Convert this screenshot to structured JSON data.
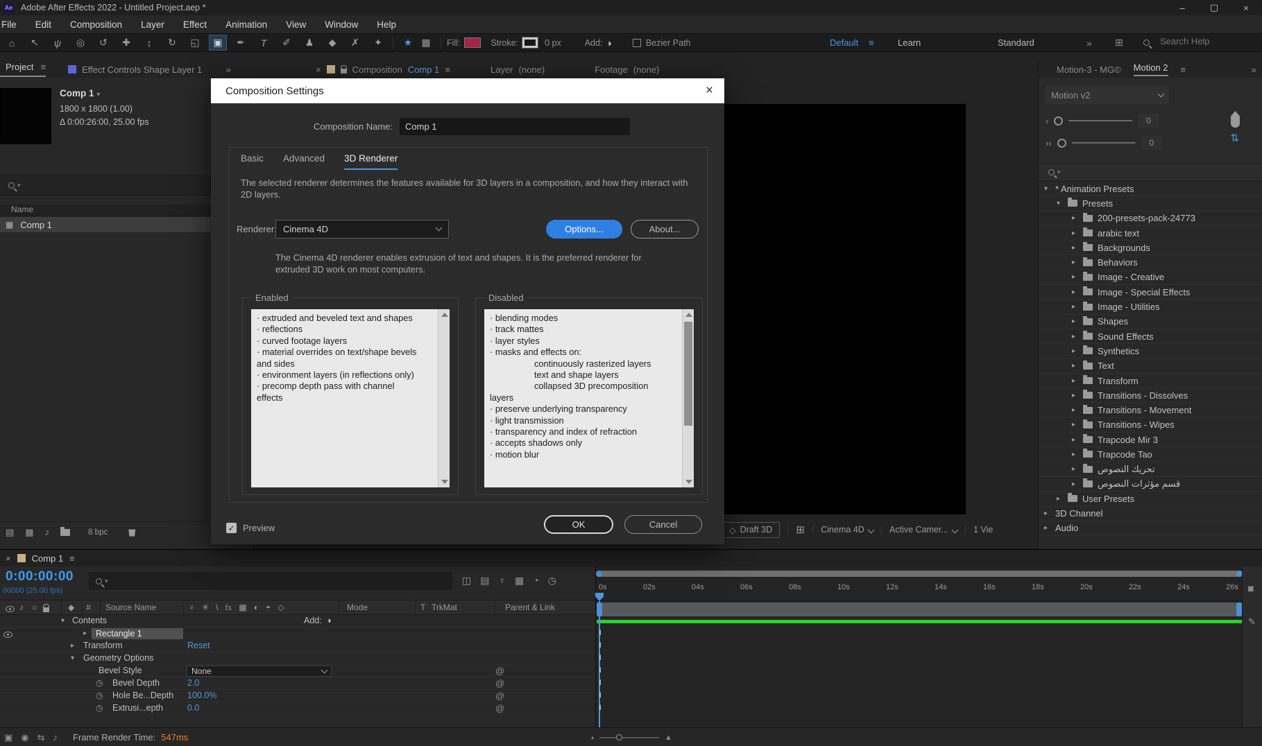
{
  "colors": {
    "accent_blue": "#4796e3",
    "fill_red": "#a32648",
    "render_bar_green": "#2ad42a",
    "frame_time_orange": "#ef7e28",
    "dialog_title_bg": "#ffffff"
  },
  "window": {
    "title": "Adobe After Effects 2022 - Untitled Project.aep *",
    "logo": "Ae",
    "minimize": "–",
    "maximize": "▢",
    "close": "×"
  },
  "menu": [
    "File",
    "Edit",
    "Composition",
    "Layer",
    "Effect",
    "Animation",
    "View",
    "Window",
    "Help"
  ],
  "toolbar": {
    "tools": [
      {
        "name": "home-tool",
        "glyph": "⌂",
        "cls": ""
      },
      {
        "name": "selection-tool",
        "glyph": "↖",
        "cls": ""
      },
      {
        "name": "hand-tool",
        "glyph": "ψ",
        "cls": ""
      },
      {
        "name": "zoom-tool",
        "glyph": "◎",
        "cls": ""
      },
      {
        "name": "orbit-camera-tool",
        "glyph": "↺",
        "cls": ""
      },
      {
        "name": "pan-camera-tool",
        "glyph": "✚",
        "cls": ""
      },
      {
        "name": "dolly-camera-tool",
        "glyph": "↕",
        "cls": ""
      },
      {
        "name": "rotation-tool",
        "glyph": "↻",
        "cls": ""
      },
      {
        "name": "pan-behind-tool",
        "glyph": "◱",
        "cls": ""
      },
      {
        "name": "rectangle-tool",
        "glyph": "▣",
        "cls": "active"
      },
      {
        "name": "pen-tool",
        "glyph": "✒",
        "cls": ""
      },
      {
        "name": "type-tool",
        "glyph": "T",
        "cls": ""
      },
      {
        "name": "brush-tool",
        "glyph": "✐",
        "cls": ""
      },
      {
        "name": "clone-stamp-tool",
        "glyph": "♟",
        "cls": ""
      },
      {
        "name": "eraser-tool",
        "glyph": "◆",
        "cls": ""
      },
      {
        "name": "roto-brush-tool",
        "glyph": "✗",
        "cls": ""
      },
      {
        "name": "puppet-pin-tool",
        "glyph": "✦",
        "cls": ""
      }
    ],
    "star_icon": "★",
    "grid_icon": "▦",
    "fill_label": "Fill:",
    "stroke_label": "Stroke:",
    "stroke_width": "0 px",
    "add_label": "Add:",
    "add_icon": "◑",
    "bezier_label": "Bezier Path",
    "workspace": "Default",
    "workspace_menu_icon": "≡",
    "learn": "Learn",
    "standard": "Standard",
    "overflow_icon": "»",
    "panel_icon": "⊞",
    "search_placeholder": "Search Help"
  },
  "project": {
    "tab": "Project",
    "panel_menu_icon": "≡",
    "tab_effect_controls": "Effect Controls Shape Layer 1",
    "overflow_icon": "»",
    "comp_name": "Comp 1",
    "comp_caret": "▾",
    "dims": "1800 x 1800 (1.00)",
    "duration": "Δ 0:00:26:00, 25.00 fps",
    "name_col": "Name",
    "row_comp": "Comp 1",
    "row_icon": "▦",
    "footer_icons": [
      {
        "name": "flowchart-icon",
        "glyph": "▤"
      },
      {
        "name": "grid-icon",
        "glyph": "▦"
      },
      {
        "name": "speaker-icon",
        "glyph": "♪"
      }
    ],
    "bpc": "8 bpc"
  },
  "viewer": {
    "tab_close": "×",
    "tab_label": "Composition",
    "tab_comp": "Comp 1",
    "panel_menu_icon": "≡",
    "layer_label": "Layer",
    "layer_value": "(none)",
    "footage_label": "Footage",
    "footage_value": "(none)",
    "draft3d_icon": "◇",
    "draft3d": "Draft 3D",
    "layout_icon": "⊞",
    "renderer": "Cinema 4D",
    "camera": "Active Camer...",
    "views": "1 Vie"
  },
  "dialog": {
    "title": "Composition Settings",
    "close": "×",
    "name_label": "Composition Name:",
    "name_value": "Comp 1",
    "tabs": [
      {
        "label": "Basic",
        "cls": ""
      },
      {
        "label": "Advanced",
        "cls": ""
      },
      {
        "label": "3D Renderer",
        "cls": "active"
      }
    ],
    "description_line1": "The selected renderer determines the features available for 3D layers in a composition, and how they interact with",
    "description_line2": "2D layers.",
    "renderer_label": "Renderer:",
    "renderer_value": "Cinema 4D",
    "options_button": "Options...",
    "about_button": "About...",
    "note_line1": "The Cinema 4D renderer enables extrusion of text and shapes. It is the preferred renderer for",
    "note_line2": "extruded 3D work on most computers.",
    "enabled_label": "Enabled",
    "enabled_items": [
      {
        "t": "· extruded and beveled text and shapes",
        "cls": ""
      },
      {
        "t": "· reflections",
        "cls": ""
      },
      {
        "t": "· curved footage layers",
        "cls": ""
      },
      {
        "t": "· material overrides on text/shape bevels",
        "cls": ""
      },
      {
        "t": "and sides",
        "cls": ""
      },
      {
        "t": "· environment layers (in reflections only)",
        "cls": ""
      },
      {
        "t": "· precomp depth pass with channel",
        "cls": ""
      },
      {
        "t": "effects",
        "cls": ""
      }
    ],
    "disabled_label": "Disabled",
    "disabled_items": [
      {
        "t": "· blending modes",
        "cls": ""
      },
      {
        "t": "· track mattes",
        "cls": ""
      },
      {
        "t": "· layer styles",
        "cls": ""
      },
      {
        "t": "· masks and effects on:",
        "cls": ""
      },
      {
        "t": "continuously rasterized layers",
        "cls": "ind"
      },
      {
        "t": "text and shape layers",
        "cls": "ind"
      },
      {
        "t": "collapsed 3D precomposition",
        "cls": "ind"
      },
      {
        "t": "layers",
        "cls": ""
      },
      {
        "t": "· preserve underlying transparency",
        "cls": ""
      },
      {
        "t": "· light transmission",
        "cls": ""
      },
      {
        "t": "· transparency and index of refraction",
        "cls": ""
      },
      {
        "t": "· accepts shadows only",
        "cls": ""
      },
      {
        "t": "· motion blur",
        "cls": ""
      }
    ],
    "preview_label": "Preview",
    "preview_check": "✓",
    "ok": "OK",
    "cancel": "Cancel"
  },
  "presets": {
    "tab1": "Motion-3 - MG©",
    "tab2": "Motion 2",
    "panel_menu_icon": "≡",
    "overflow_icon": "»",
    "dropdown": "Motion v2",
    "slider1_icon": "‹",
    "slider1_value": "0",
    "slider2_icon": "›‹",
    "slider2_value": "0",
    "updown_icon": "⇅",
    "tree": [
      {
        "label": "* Animation Presets",
        "cls": "lvl0 open"
      },
      {
        "label": "Presets",
        "cls": "lvl1 open folder"
      },
      {
        "label": "200-presets-pack-24773",
        "cls": "lvl2 closed folder"
      },
      {
        "label": "arabic text",
        "cls": "lvl2 closed folder"
      },
      {
        "label": "Backgrounds",
        "cls": "lvl2 closed folder"
      },
      {
        "label": "Behaviors",
        "cls": "lvl2 closed folder"
      },
      {
        "label": "Image - Creative",
        "cls": "lvl2 closed folder"
      },
      {
        "label": "Image - Special Effects",
        "cls": "lvl2 closed folder"
      },
      {
        "label": "Image - Utilities",
        "cls": "lvl2 closed folder"
      },
      {
        "label": "Shapes",
        "cls": "lvl2 closed folder"
      },
      {
        "label": "Sound Effects",
        "cls": "lvl2 closed folder"
      },
      {
        "label": "Synthetics",
        "cls": "lvl2 closed folder"
      },
      {
        "label": "Text",
        "cls": "lvl2 closed folder"
      },
      {
        "label": "Transform",
        "cls": "lvl2 closed folder"
      },
      {
        "label": "Transitions - Dissolves",
        "cls": "lvl2 closed folder"
      },
      {
        "label": "Transitions - Movement",
        "cls": "lvl2 closed folder"
      },
      {
        "label": "Transitions - Wipes",
        "cls": "lvl2 closed folder"
      },
      {
        "label": "Trapcode Mir 3",
        "cls": "lvl2 closed folder"
      },
      {
        "label": "Trapcode Tao",
        "cls": "lvl2 closed folder"
      },
      {
        "label": "تحريك النصوص",
        "cls": "lvl2 closed folder"
      },
      {
        "label": "قسم مؤثرات النصوص",
        "cls": "lvl2 closed folder"
      },
      {
        "label": "User Presets",
        "cls": "lvl1 closed folder"
      },
      {
        "label": "3D Channel",
        "cls": "lvl0 closed"
      },
      {
        "label": "Audio",
        "cls": "lvl0 closed"
      }
    ]
  },
  "timeline": {
    "tab_close": "×",
    "tab": "Comp 1",
    "panel_menu_icon": "≡",
    "timecode": "0:00:00:00",
    "frames": "00000 (25.00 fps)",
    "cluster_icons": [
      {
        "name": "comp-mini-flowchart-icon",
        "glyph": "◫"
      },
      {
        "name": "draft-3d-toggle-icon",
        "glyph": "▤"
      },
      {
        "name": "hide-shy-layers-icon",
        "glyph": "♀"
      },
      {
        "name": "frame-blending-toggle-icon",
        "glyph": "▦"
      },
      {
        "name": "motion-blur-toggle-icon",
        "glyph": "◔"
      },
      {
        "name": "graph-editor-icon",
        "glyph": "◷"
      }
    ],
    "header": {
      "hash": "#",
      "source": "Source Name",
      "mode": "Mode",
      "t": "T",
      "trkmat": "TrkMat",
      "parent": "Parent & Link",
      "tag_icon": "◆",
      "audio_icon": "♪",
      "solo_icon": "○"
    },
    "switch_icons": [
      {
        "name": "shy-icon",
        "glyph": "♀"
      },
      {
        "name": "collapse-transformations-icon",
        "glyph": "✳"
      },
      {
        "name": "quality-icon",
        "glyph": "\\"
      },
      {
        "name": "fx-icon",
        "glyph": "fx"
      },
      {
        "name": "frame-blend-icon",
        "glyph": "▦"
      },
      {
        "name": "motion-blur-icon",
        "glyph": "◐"
      },
      {
        "name": "adjustment-layer-icon",
        "glyph": "◓"
      },
      {
        "name": "3d-layer-icon",
        "glyph": "◇"
      }
    ],
    "row_contents": "Contents",
    "add_label": "Add:",
    "add_icon": "◑",
    "row_rect": "Rectangle 1",
    "row_transform": "Transform",
    "transform_value": "Reset",
    "row_geo": "Geometry Options",
    "row_bevel_style": "Bevel Style",
    "bevel_style_value": "None",
    "row_bevel_depth": "Bevel Depth",
    "bevel_depth_value": "2.0",
    "row_hole": "Hole Be...Depth",
    "hole_value": "100.0%",
    "row_extrusion": "Extrusi...epth",
    "extrusion_value": "0.0",
    "stopwatch_icon": "◷",
    "pickwhip_icon": "@",
    "ruler": [
      "0s",
      "02s",
      "04s",
      "06s",
      "08s",
      "10s",
      "12s",
      "14s",
      "16s",
      "18s",
      "20s",
      "22s",
      "24s",
      "26s"
    ],
    "gutter_marker_icon": "◙",
    "gutter_pencil_icon": "✎",
    "status_icons": [
      {
        "name": "render-status-icon",
        "glyph": "▣"
      },
      {
        "name": "snapshot-icon",
        "glyph": "◉"
      },
      {
        "name": "in-out-icon",
        "glyph": "⇆"
      },
      {
        "name": "audio-preview-icon",
        "glyph": "♪"
      }
    ],
    "status_label": "Frame Render Time:",
    "status_value": "547ms"
  }
}
